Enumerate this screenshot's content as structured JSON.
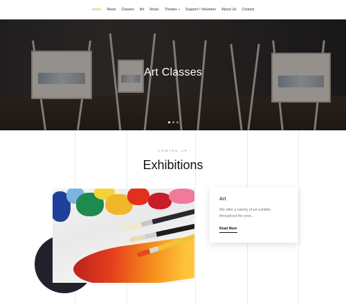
{
  "nav": {
    "items": [
      {
        "label": "Home",
        "active": true
      },
      {
        "label": "News"
      },
      {
        "label": "Classes"
      },
      {
        "label": "Art"
      },
      {
        "label": "Music"
      },
      {
        "label": "Theatre",
        "dropdown": true
      },
      {
        "label": "Support / Volunteer"
      },
      {
        "label": "About Us"
      },
      {
        "label": "Contact"
      }
    ],
    "active_color": "#d9a53b"
  },
  "hero": {
    "title": "Art Classes",
    "slides_total": 3,
    "slide_active_index": 0
  },
  "section": {
    "eyebrow": "COMING UP",
    "title": "Exhibitions"
  },
  "card": {
    "title": "Art",
    "text": "We offer a variety of art exhibits throughout the year...",
    "link_label": "Read More"
  },
  "icons": {
    "dropdown": "chevron-down-icon"
  }
}
